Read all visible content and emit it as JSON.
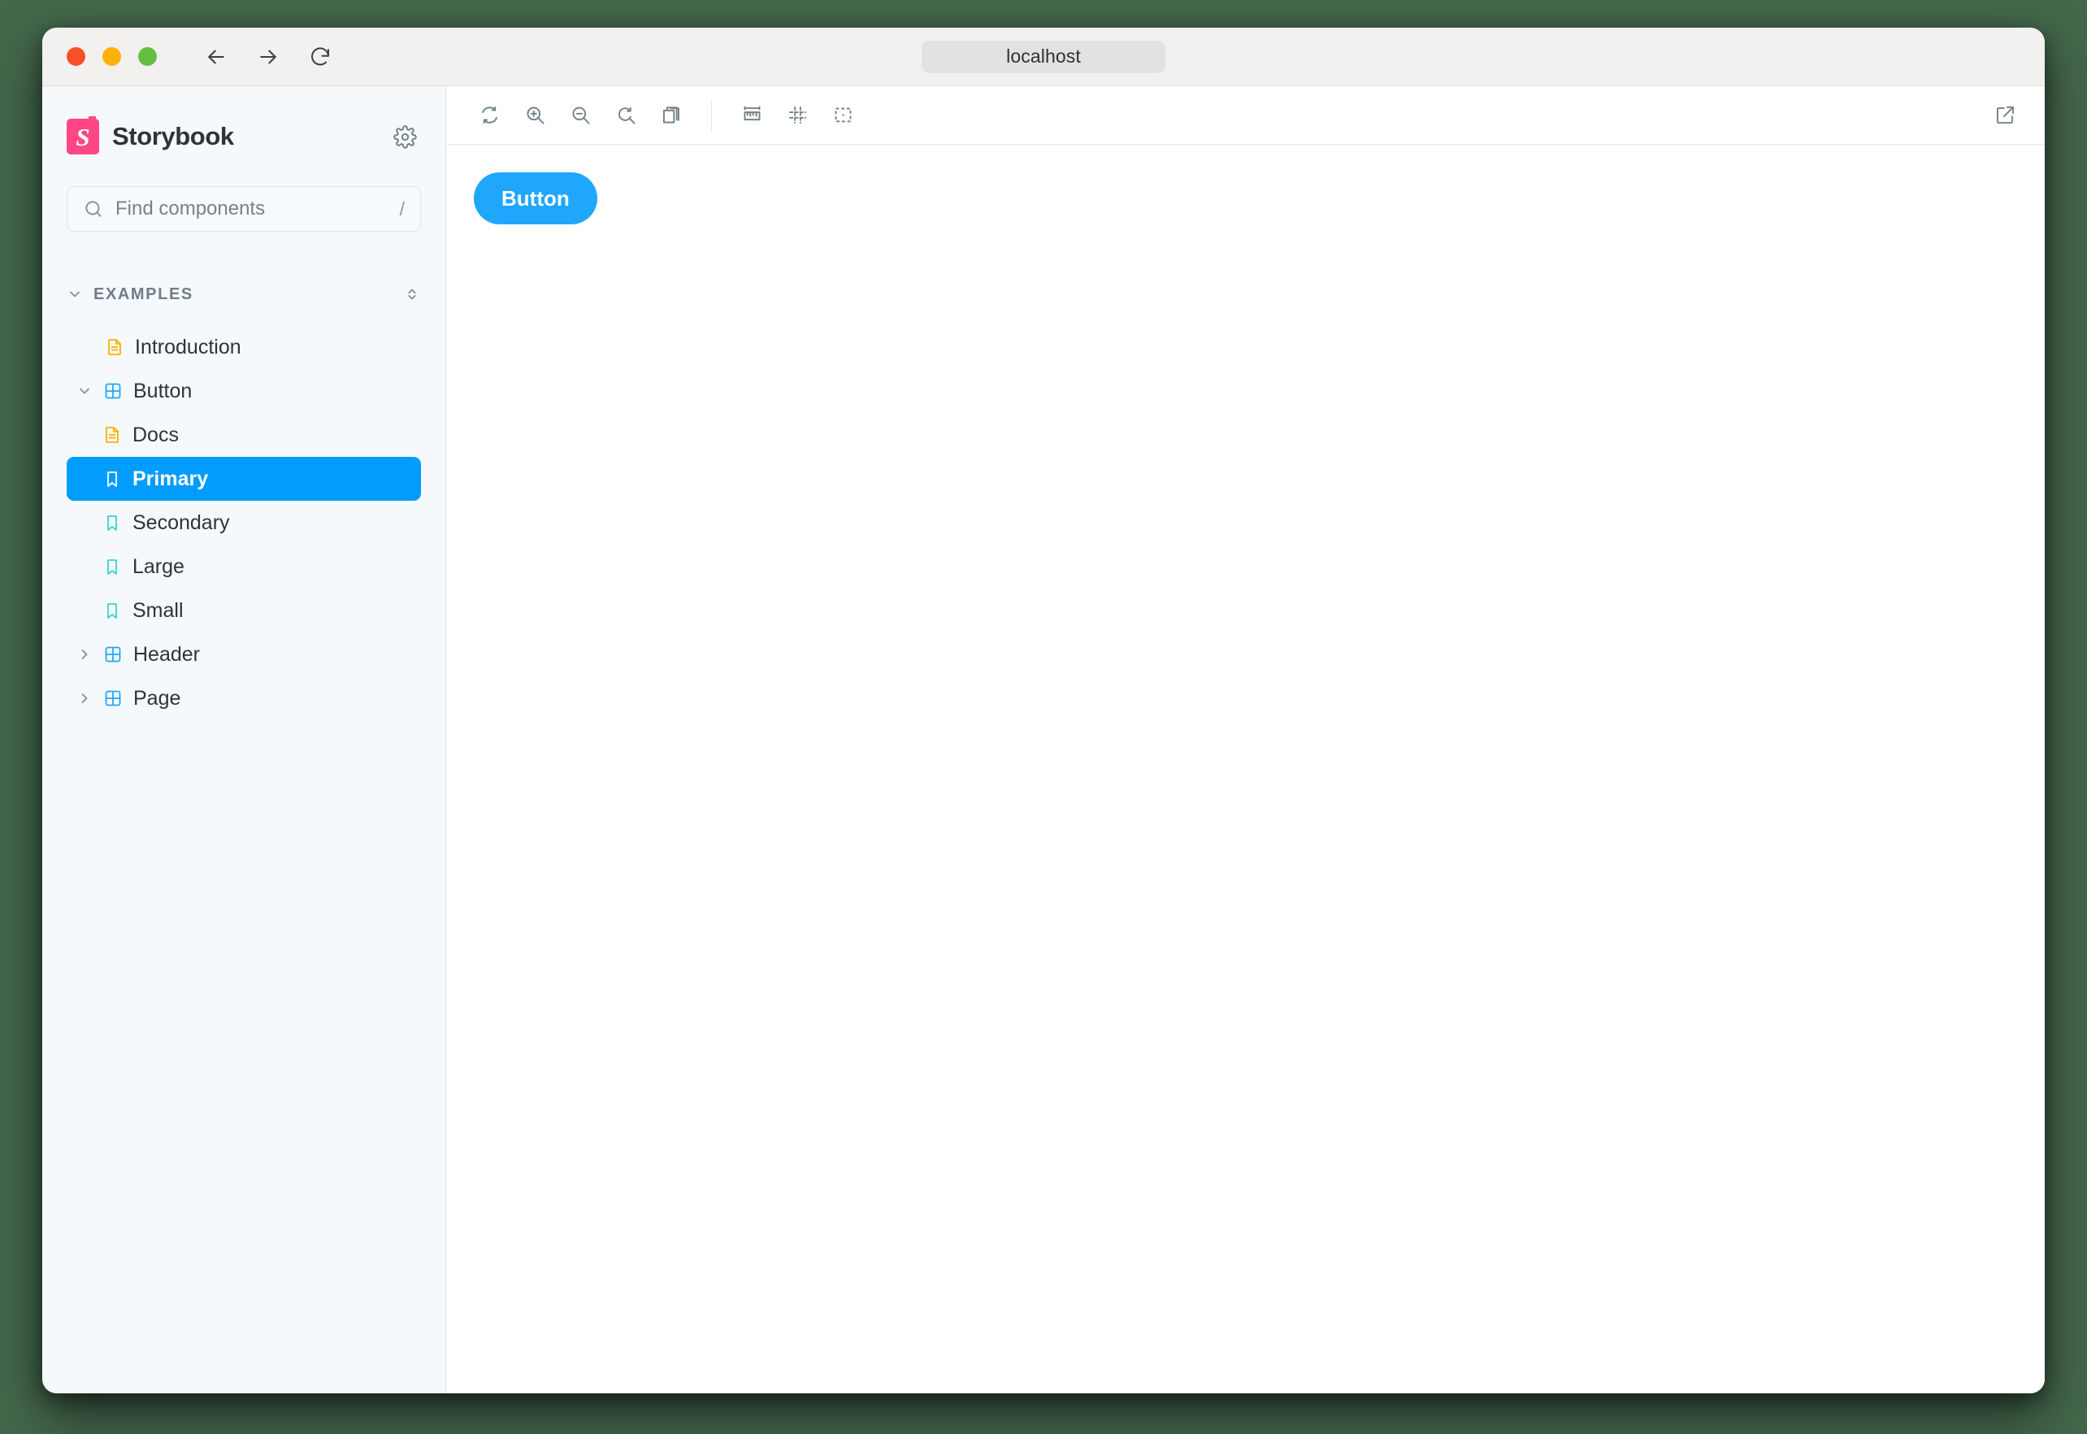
{
  "browser": {
    "address": "localhost",
    "nav": {
      "back_label": "Back",
      "forward_label": "Forward",
      "reload_label": "Reload"
    },
    "window_controls": {
      "close_label": "Close",
      "minimize_label": "Minimize",
      "maximize_label": "Maximize"
    }
  },
  "sidebar": {
    "brand_name": "Storybook",
    "brand_initial": "S",
    "settings_label": "Settings",
    "search": {
      "placeholder": "Find components",
      "shortcut": "/"
    },
    "root": {
      "label": "EXAMPLES",
      "expanded": true,
      "expand_all_label": "Expand all"
    },
    "items": [
      {
        "label": "Introduction",
        "icon": "document-icon",
        "level": 1,
        "expandable": false,
        "expanded": false,
        "selected": false
      },
      {
        "label": "Button",
        "icon": "component-icon",
        "level": 1,
        "expandable": true,
        "expanded": true,
        "selected": false
      },
      {
        "label": "Docs",
        "icon": "document-icon",
        "level": 2,
        "expandable": false,
        "expanded": false,
        "selected": false
      },
      {
        "label": "Primary",
        "icon": "story-icon",
        "level": 2,
        "expandable": false,
        "expanded": false,
        "selected": true
      },
      {
        "label": "Secondary",
        "icon": "story-icon",
        "level": 2,
        "expandable": false,
        "expanded": false,
        "selected": false
      },
      {
        "label": "Large",
        "icon": "story-icon",
        "level": 2,
        "expandable": false,
        "expanded": false,
        "selected": false
      },
      {
        "label": "Small",
        "icon": "story-icon",
        "level": 2,
        "expandable": false,
        "expanded": false,
        "selected": false
      },
      {
        "label": "Header",
        "icon": "component-icon",
        "level": 1,
        "expandable": true,
        "expanded": false,
        "selected": false
      },
      {
        "label": "Page",
        "icon": "component-icon",
        "level": 1,
        "expandable": true,
        "expanded": false,
        "selected": false
      }
    ]
  },
  "toolbar": {
    "left_tools": [
      {
        "name": "remount-icon",
        "label": "Remount component"
      },
      {
        "name": "zoom-in-icon",
        "label": "Zoom in"
      },
      {
        "name": "zoom-out-icon",
        "label": "Zoom out"
      },
      {
        "name": "zoom-reset-icon",
        "label": "Reset zoom"
      },
      {
        "name": "backgrounds-icon",
        "label": "Change the background of the preview"
      }
    ],
    "right_tools": [
      {
        "name": "measure-icon",
        "label": "Enable measure"
      },
      {
        "name": "grid-icon",
        "label": "Apply a grid to the preview"
      },
      {
        "name": "outline-icon",
        "label": "Apply outlines to the preview"
      }
    ],
    "open_new_tab_label": "Open canvas in new tab"
  },
  "canvas": {
    "story_button_label": "Button",
    "accent_color": "#1ea7fd"
  },
  "colors": {
    "brand_pink": "#ff4785",
    "selected_blue": "#029cfd",
    "story_icon": "#37d5d3",
    "document_icon": "#ffae00",
    "component_icon": "#1ea7fd",
    "page_background": "#43674b"
  }
}
